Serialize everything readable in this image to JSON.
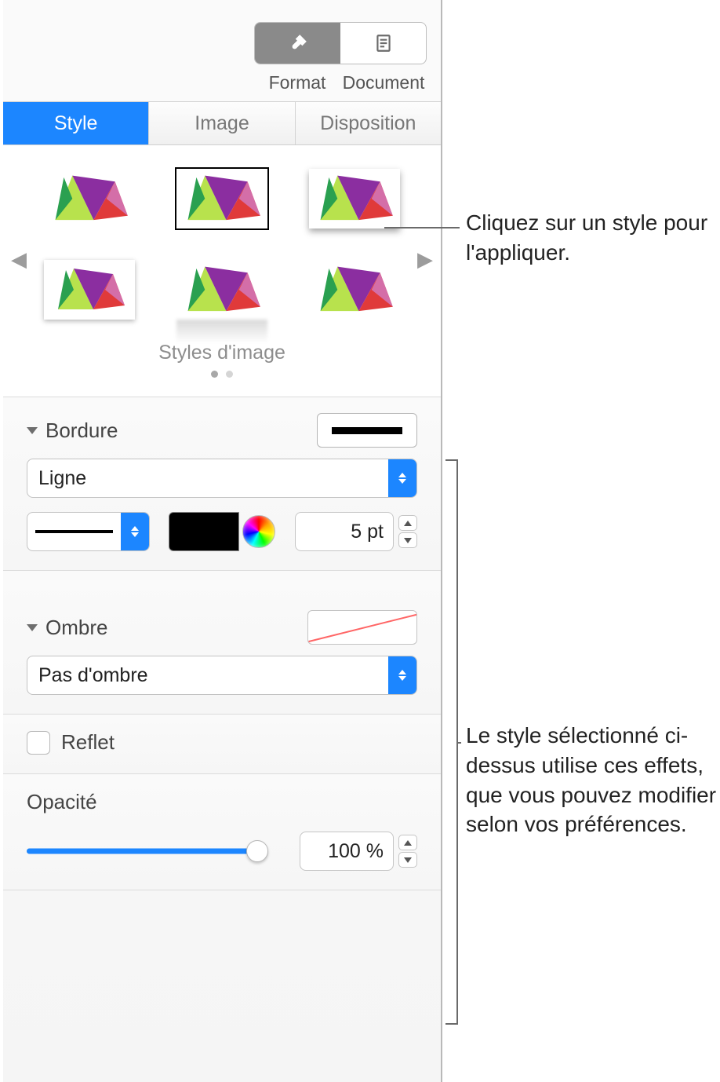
{
  "toolbar": {
    "format_label": "Format",
    "document_label": "Document"
  },
  "tabs": {
    "style": "Style",
    "image": "Image",
    "layout": "Disposition"
  },
  "gallery": {
    "title": "Styles d'image"
  },
  "border": {
    "title": "Bordure",
    "type_value": "Ligne",
    "width_value": "5 pt"
  },
  "shadow": {
    "title": "Ombre",
    "value": "Pas d'ombre"
  },
  "reflection": {
    "title": "Reflet"
  },
  "opacity": {
    "title": "Opacité",
    "value": "100 %"
  },
  "callouts": {
    "top": "Cliquez sur un style pour l'appliquer.",
    "bottom": "Le style sélectionné ci-dessus utilise ces effets, que vous pouvez modifier selon vos préférences."
  }
}
